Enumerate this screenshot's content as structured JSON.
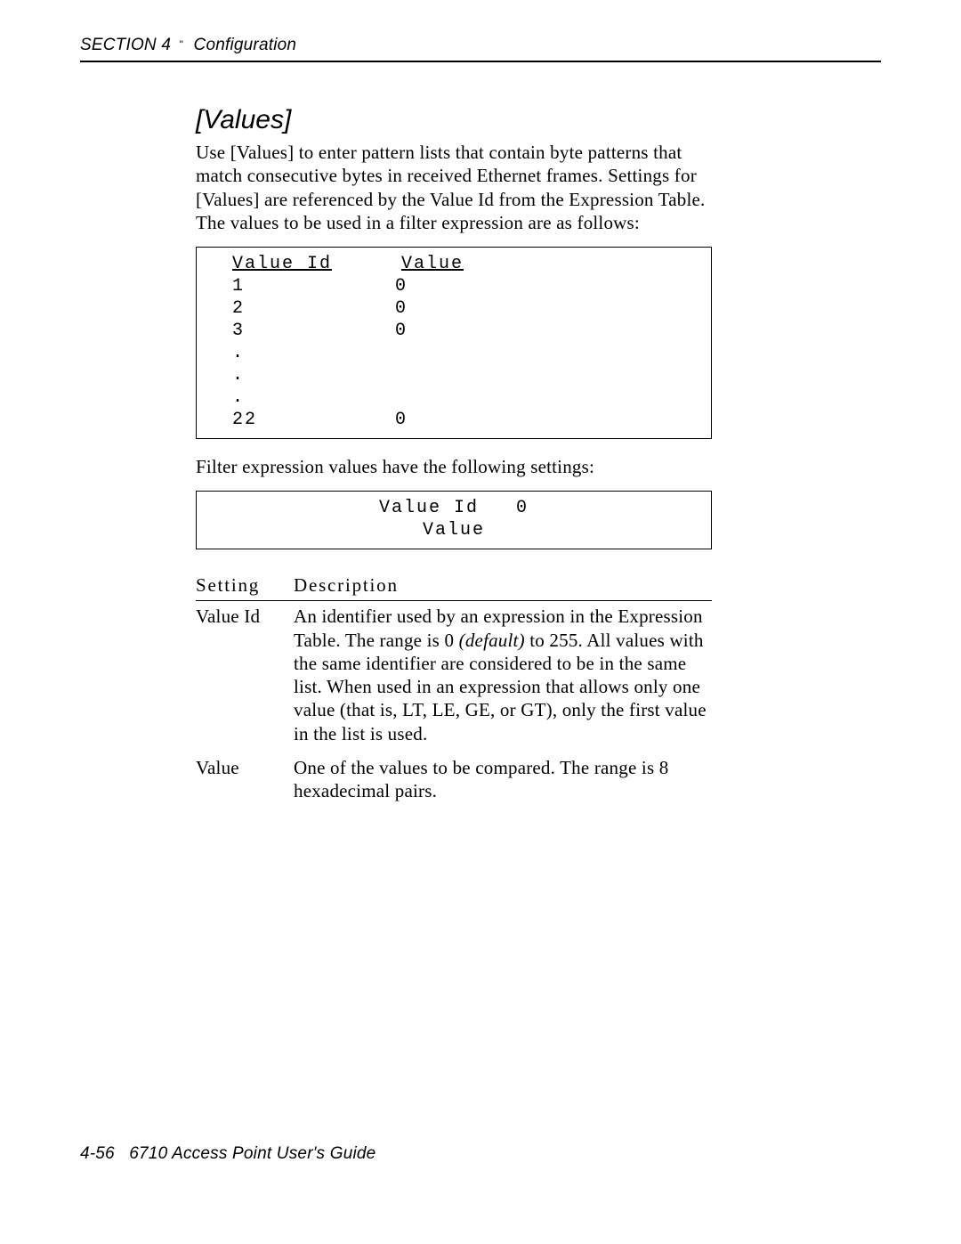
{
  "header": {
    "section_label": "SECTION 4",
    "glyph": "\"",
    "subject": "Configuration"
  },
  "section": {
    "title": "[Values]",
    "intro": "Use [Values] to enter pattern lists that contain byte patterns that match consecutive bytes in received Ethernet frames.  Settings for [Values] are referenced by the Value Id from the Expression Table.  The values to be used in a filter expression are as follows:"
  },
  "value_id_box": {
    "header_id": "Value Id",
    "header_val": "Value",
    "rows": [
      {
        "id": "1",
        "val": "0"
      },
      {
        "id": "2",
        "val": "0"
      },
      {
        "id": "3",
        "val": "0"
      }
    ],
    "dots": [
      ".",
      ".",
      "."
    ],
    "last_row": {
      "id": "22",
      "val": "0"
    }
  },
  "para2": "Filter expression values have the following settings:",
  "settings_box": {
    "line1_label": "Value Id",
    "line1_value": "0",
    "line2_label": "Value"
  },
  "settings_table": {
    "header_setting": "Setting",
    "header_description": "Description",
    "rows": [
      {
        "setting": "Value Id",
        "desc_before": "An identifier used by an expression in the Expression Table.  The range is 0 ",
        "desc_italic": "(default)",
        "desc_after": " to 255.  All values with the same identifier are considered to be in the same list.  When used in an expression that allows only one value (that is, LT, LE, GE, or GT), only the first value in the list is used."
      },
      {
        "setting": "Value",
        "desc_before": "One of the values to be compared.  The range is 8 hexadecimal pairs.",
        "desc_italic": "",
        "desc_after": ""
      }
    ]
  },
  "footer": {
    "page_num": "4-56",
    "book": "6710 Access Point User's Guide"
  }
}
